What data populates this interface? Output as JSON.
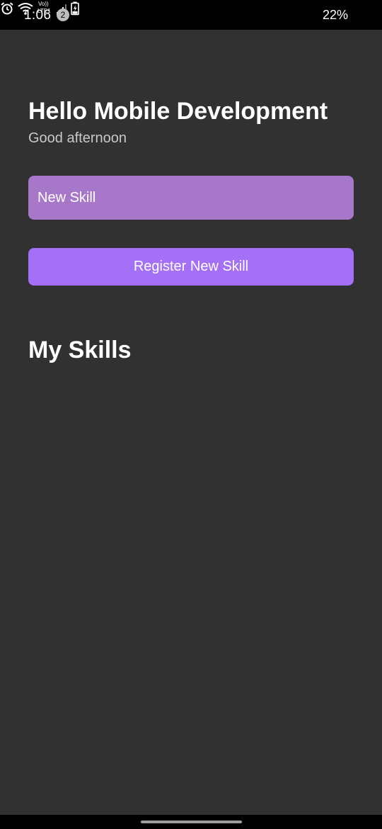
{
  "status_bar": {
    "time": "1:06",
    "notification_count": "2",
    "icons": [
      "alarm-icon",
      "wifi-icon",
      "volte-lte-icon",
      "signal-icon",
      "battery-charging-icon"
    ],
    "battery_percent": "22%"
  },
  "header": {
    "title": "Hello Mobile Development",
    "subtitle": "Good afternoon"
  },
  "form": {
    "skill_input_placeholder": "New Skill",
    "skill_input_value": "",
    "register_button_label": "Register New Skill"
  },
  "skills": {
    "title": "My Skills",
    "items": []
  },
  "colors": {
    "background": "#313131",
    "input_background": "#a777c9",
    "button_background": "#a370f7",
    "text": "#ffffff",
    "subtitle_text": "#c9c9c9"
  }
}
